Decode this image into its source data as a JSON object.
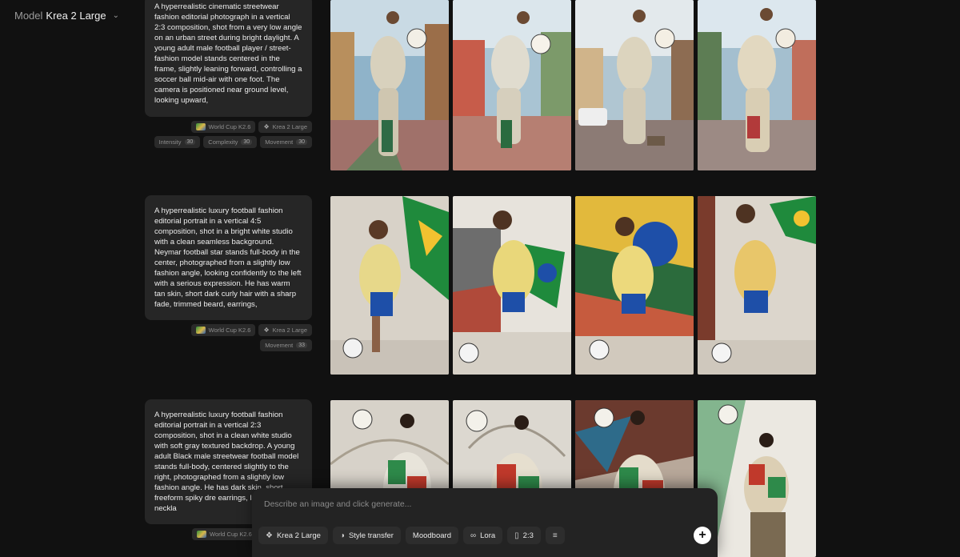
{
  "model": {
    "label": "Model",
    "value": "Krea 2 Large"
  },
  "rows": [
    {
      "prompt": "A hyperrealistic cinematic streetwear fashion editorial photograph in a vertical 2:3 composition, shot from a very low angle on an urban street during bright daylight. A young adult male football player / street-fashion model stands centered in the frame, slightly leaning forward, controlling a soccer ball mid-air with one foot. The camera is positioned near ground level, looking upward,",
      "style_chip": "World Cup K2.6",
      "model_chip": "Krea 2 Large",
      "params": [
        {
          "label": "Intensity",
          "value": "30"
        },
        {
          "label": "Complexity",
          "value": "30"
        },
        {
          "label": "Movement",
          "value": "30"
        }
      ]
    },
    {
      "prompt": "A hyperrealistic luxury football fashion editorial portrait in a vertical 4:5 composition, shot in a bright white studio with a clean seamless background. Neymar football star stands full-body in the center, photographed from a slightly low fashion angle, looking confidently to the left with a serious expression. He has warm tan skin, short dark curly hair with a sharp fade, trimmed beard, earrings,",
      "style_chip": "World Cup K2.6",
      "model_chip": "Krea 2 Large",
      "params": [
        {
          "label": "Movement",
          "value": "33"
        }
      ]
    },
    {
      "prompt": "A hyperrealistic luxury football fashion editorial portrait in a vertical 2:3 composition, shot in a clean white studio with soft gray textured backdrop. A young adult Black male streetwear football model stands full-body, centered slightly to the right, photographed from a slightly low fashion angle. He has dark skin, short freeform spiky dre earrings, layered silver neckla",
      "style_chip": "World Cup K2.6"
    }
  ],
  "composer": {
    "placeholder": "Describe an image and click generate...",
    "model_button": "Krea 2 Large",
    "style_transfer": "Style transfer",
    "moodboard": "Moodboard",
    "lora": "Lora",
    "ratio": "2:3"
  },
  "icons": {
    "model": "krea-icon",
    "style": "palette-icon",
    "lora": "lora-icon",
    "ratio": "portrait-ratio-icon",
    "settings": "sliders-icon",
    "generate": "plus-icon",
    "chevron": "chevron-down-icon"
  },
  "colors": {
    "background": "#111111",
    "card": "#262626",
    "brazil_green": "#1f8a3c",
    "brazil_yellow": "#f2c230",
    "brazil_blue": "#1e4fa8"
  }
}
